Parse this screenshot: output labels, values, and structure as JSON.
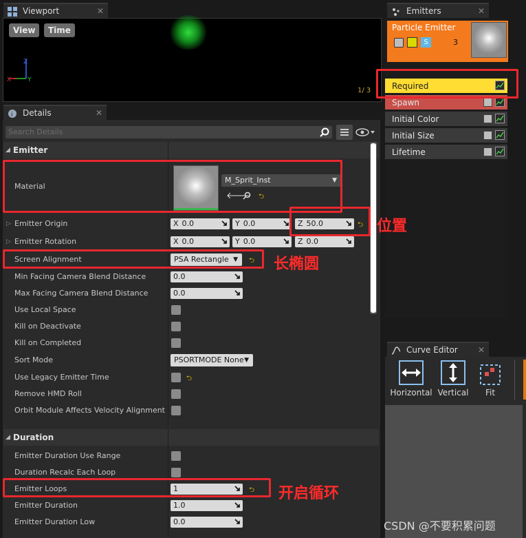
{
  "viewport": {
    "tab_label": "Viewport",
    "view_btn": "View",
    "time_btn": "Time",
    "frame_counter": "1/  3"
  },
  "emitters": {
    "tab_label": "Emitters",
    "emitter_name": "Particle Emitter",
    "s_badge": "S",
    "count": "3",
    "modules": [
      {
        "label": "Required",
        "color": "#ffdd33"
      },
      {
        "label": "Spawn",
        "color": "#c8504a"
      },
      {
        "label": "Initial Color",
        "color": "#3a3a3a"
      },
      {
        "label": "Initial Size",
        "color": "#3a3a3a"
      },
      {
        "label": "Lifetime",
        "color": "#3a3a3a"
      }
    ]
  },
  "details": {
    "tab_label": "Details",
    "search_placeholder": "Search Details",
    "emitter_section": "Emitter",
    "material_label": "Material",
    "material_value": "M_Sprit_Inst",
    "emitter_origin": {
      "label": "Emitter Origin",
      "x": "0.0",
      "y": "0.0",
      "z": "50.0"
    },
    "emitter_rotation": {
      "label": "Emitter Rotation",
      "x": "0.0",
      "y": "0.0",
      "z": "0.0"
    },
    "axis_x": "X",
    "axis_y": "Y",
    "axis_z": "Z",
    "screen_alignment": {
      "label": "Screen Alignment",
      "value": "PSA Rectangle"
    },
    "min_facing": {
      "label": "Min Facing Camera Blend Distance",
      "value": "0.0"
    },
    "max_facing": {
      "label": "Max Facing Camera Blend Distance",
      "value": "0.0"
    },
    "use_local_space": "Use Local Space",
    "kill_on_deactivate": "Kill on Deactivate",
    "kill_on_completed": "Kill on Completed",
    "sort_mode": {
      "label": "Sort Mode",
      "value": "PSORTMODE None"
    },
    "use_legacy_time": "Use Legacy Emitter Time",
    "remove_hmd_roll": "Remove HMD Roll",
    "orbit_module": "Orbit Module Affects Velocity Alignment",
    "duration_section": "Duration",
    "duration_use_range": "Emitter Duration Use Range",
    "duration_recalc": "Duration Recalc Each Loop",
    "emitter_loops": {
      "label": "Emitter Loops",
      "value": "1"
    },
    "emitter_duration": {
      "label": "Emitter Duration",
      "value": "1.0"
    },
    "emitter_duration_low": {
      "label": "Emitter Duration Low",
      "value": "0.0"
    }
  },
  "curve_editor": {
    "tab_label": "Curve Editor",
    "horizontal": "Horizontal",
    "vertical": "Vertical",
    "fit": "Fit"
  },
  "annotations": {
    "position": "位置",
    "ellipse": "长椭圆",
    "loop": "开启循环"
  },
  "watermark": "CSDN @不要积累问题"
}
